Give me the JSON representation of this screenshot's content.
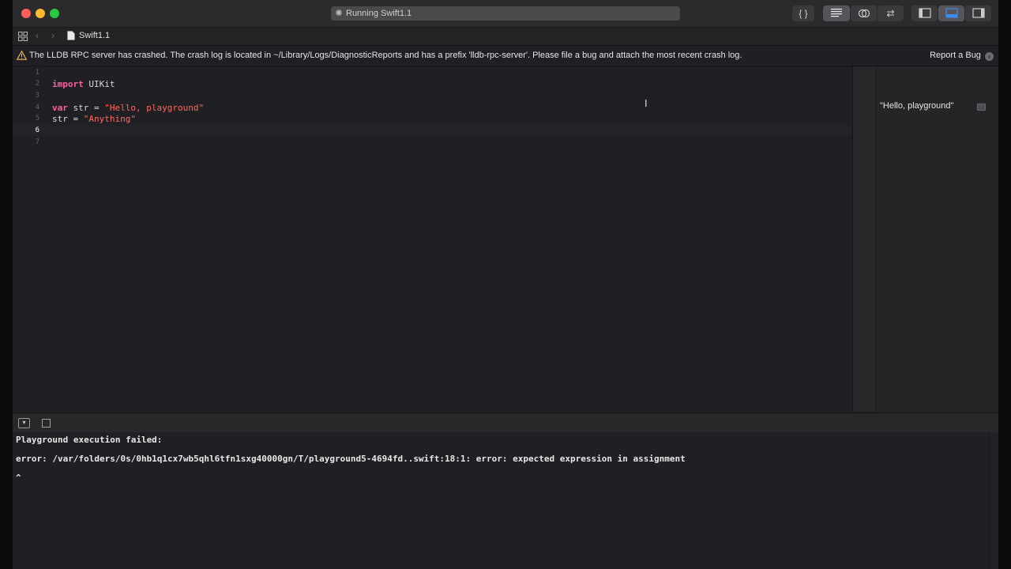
{
  "window": {
    "activity_text": "Running Swift1.1",
    "activity_spinner_icon": "spinner-icon"
  },
  "toolbar": {
    "buttons": [
      {
        "name": "library-button",
        "glyph": "{ }"
      },
      {
        "name": "standard-editor-button",
        "glyph": "standard-editor-icon"
      },
      {
        "name": "assistant-editor-button",
        "glyph": "assistant-editor-icon"
      },
      {
        "name": "version-editor-button",
        "glyph": "version-editor-icon"
      },
      {
        "name": "toggle-navigator-button",
        "glyph": "left-panel-icon"
      },
      {
        "name": "toggle-debug-area-button",
        "glyph": "bottom-panel-icon"
      },
      {
        "name": "toggle-inspector-button",
        "glyph": "right-panel-icon"
      }
    ]
  },
  "jumpbar": {
    "file_label": "Swift1.1"
  },
  "warning": {
    "message": "The LLDB RPC server has crashed. The crash log is located in ~/Library/Logs/DiagnosticReports and has a prefix 'lldb-rpc-server'. Please file a bug and attach the most recent crash log.",
    "action_label": "Report a Bug"
  },
  "editor": {
    "line_numbers": [
      "1",
      "2",
      "3",
      "4",
      "5",
      "6",
      "7"
    ],
    "current_line": "6",
    "code": {
      "l2_kw": "import",
      "l2_rest": " UIKit",
      "l4_kw": "var",
      "l4_mid": " str = ",
      "l4_str": "\"Hello, playground\"",
      "l5_mid": "str = ",
      "l5_str": "\"Anything\""
    }
  },
  "results": {
    "line4_value": "\"Hello, playground\""
  },
  "console": {
    "lines": [
      "Playground execution failed:",
      "error: /var/folders/0s/0hb1q1cx7wb5qhl6tfn1sxg40000gn/T/playground5-4694fd..swift:18:1: error: expected expression in assignment",
      "^"
    ]
  },
  "colors": {
    "keyword": "#fc5fa3",
    "string": "#fc6a5d",
    "accent": "#3b8cf5"
  }
}
